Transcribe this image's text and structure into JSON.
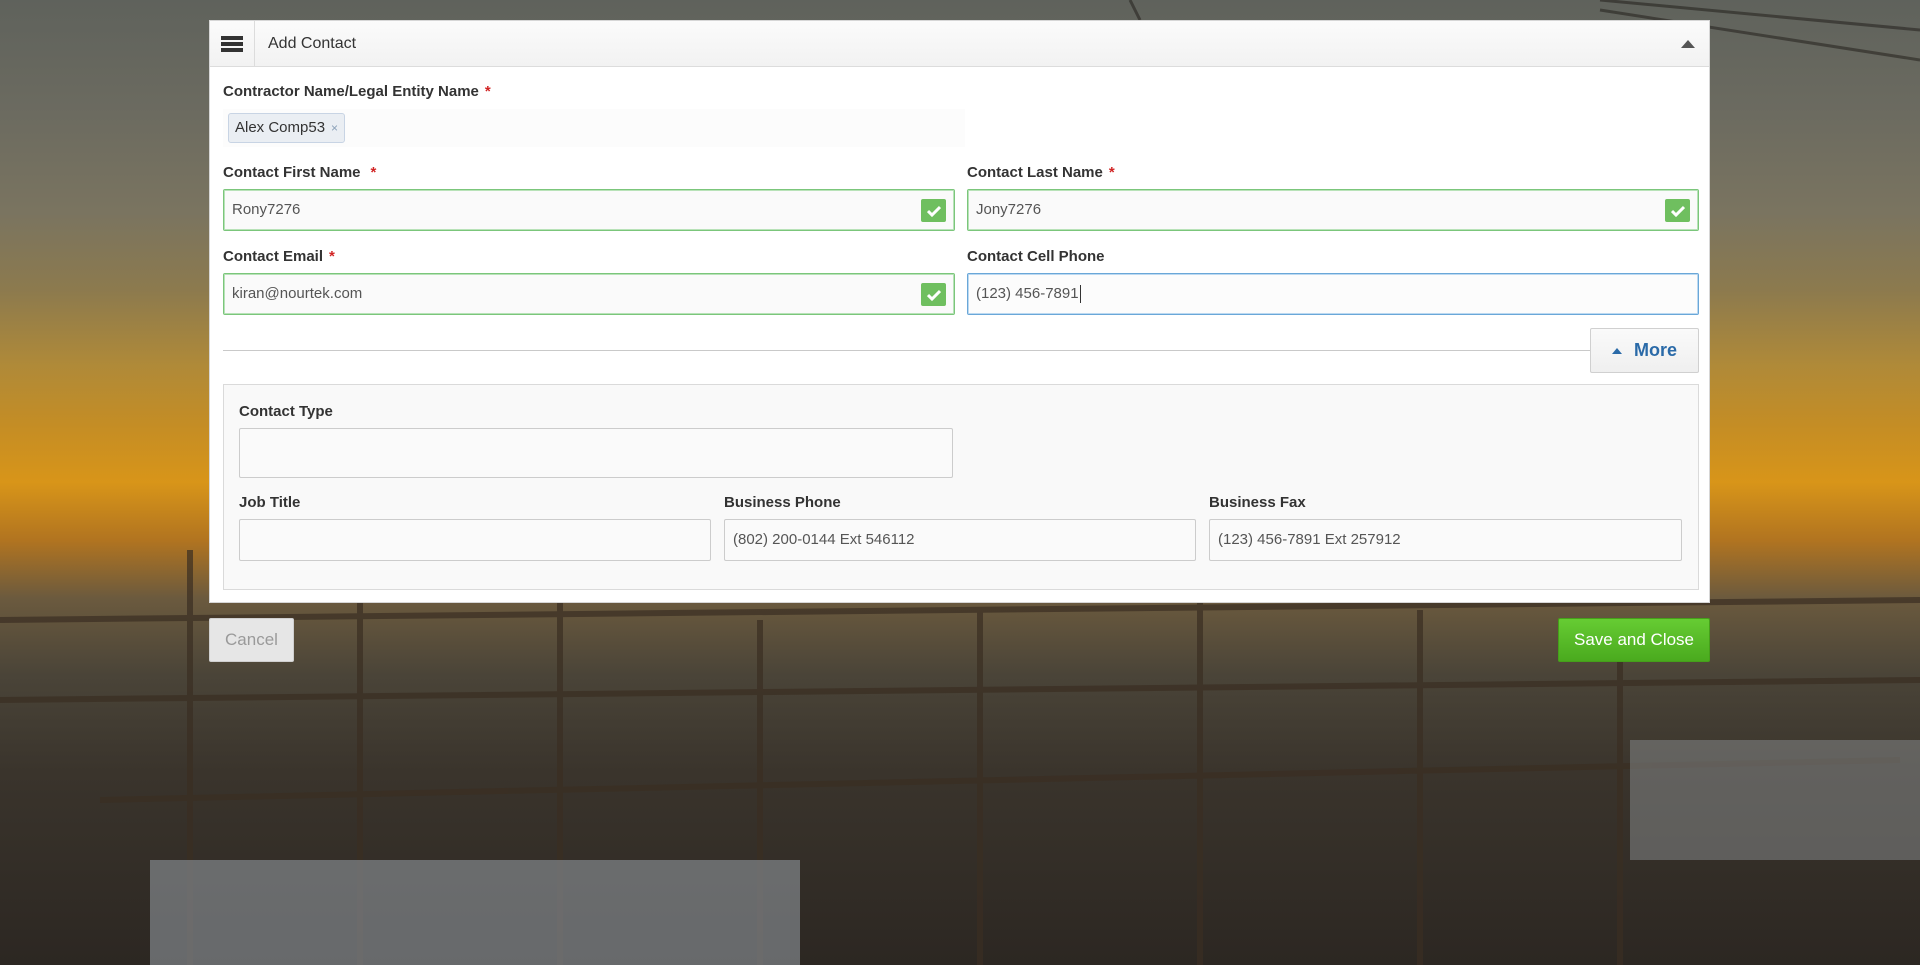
{
  "dialog": {
    "title": "Add Contact"
  },
  "form": {
    "contractor": {
      "label": "Contractor Name/Legal Entity Name",
      "required_mark": "*",
      "tag": "Alex Comp53",
      "tag_remove": "×"
    },
    "first_name": {
      "label": "Contact First Name",
      "required_mark": "*",
      "value": "Rony7276"
    },
    "last_name": {
      "label": "Contact Last Name",
      "required_mark": "*",
      "value": "Jony7276"
    },
    "email": {
      "label": "Contact Email",
      "required_mark": "*",
      "value": "kiran@nourtek.com"
    },
    "cell_phone": {
      "label": "Contact Cell Phone",
      "value": "(123) 456-7891"
    },
    "more_button": "More",
    "contact_type": {
      "label": "Contact Type",
      "value": ""
    },
    "job_title": {
      "label": "Job Title",
      "value": ""
    },
    "business_phone": {
      "label": "Business Phone",
      "value": "(802) 200-0144 Ext 546112"
    },
    "business_fax": {
      "label": "Business Fax",
      "value": "(123) 456-7891 Ext 257912"
    }
  },
  "footer": {
    "cancel_label": "Cancel",
    "save_label": "Save and Close"
  },
  "colors": {
    "save_button": "#52b322",
    "valid_border": "#7bc67b",
    "required_mark": "#d12424",
    "more_text": "#2a6aa8"
  },
  "icons": {
    "menu": "hamburger-icon",
    "collapse": "triangle-up-icon",
    "valid": "check-icon",
    "more": "triangle-up-icon"
  }
}
